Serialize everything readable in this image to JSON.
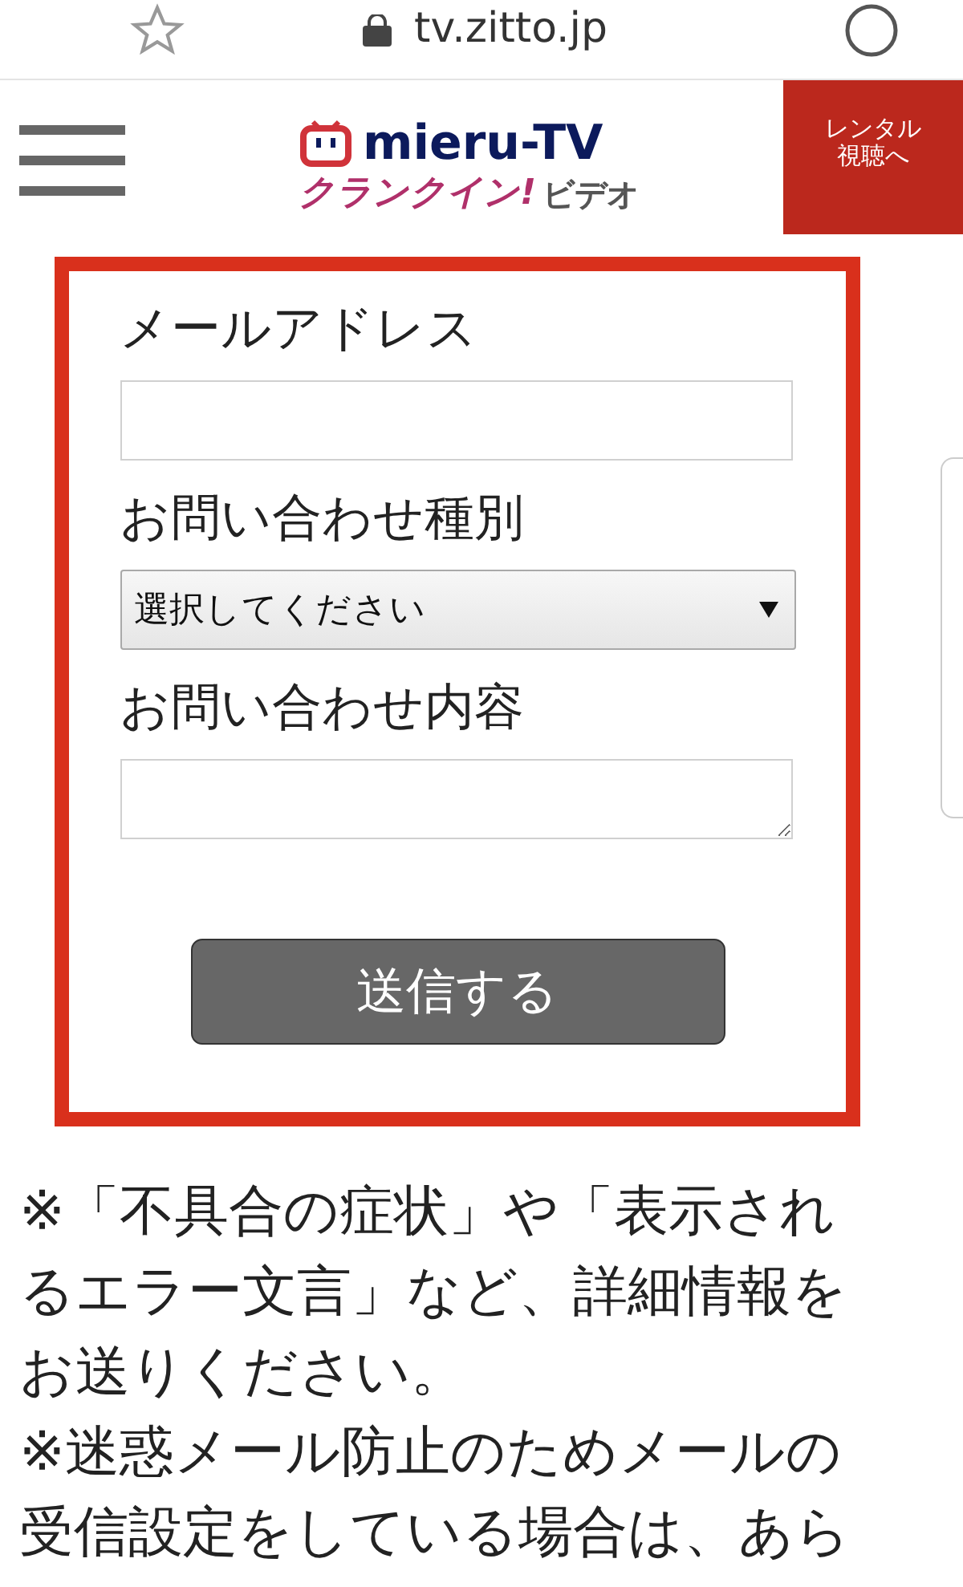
{
  "browser_bar": {
    "url": "tv.zitto.jp"
  },
  "header": {
    "logo_title": "mieru-TV",
    "logo_subtitle": "クランクイン!",
    "logo_suffix": "ビデオ",
    "rental_button": "レンタル視聴へ"
  },
  "form": {
    "fields": [
      {
        "label": "メールアドレス",
        "kind": "input"
      },
      {
        "label": "お問い合わせ種別",
        "kind": "select",
        "value": "選択してください"
      },
      {
        "label": "お問い合わせ内容",
        "kind": "textarea"
      }
    ],
    "submit": "送信する"
  },
  "notes": [
    "※「不具合の症状」や「表示されるエラー文言」など、詳細情報をお送りください。",
    "※迷惑メール防止のためメールの受信設定をしている場合は、あら"
  ]
}
